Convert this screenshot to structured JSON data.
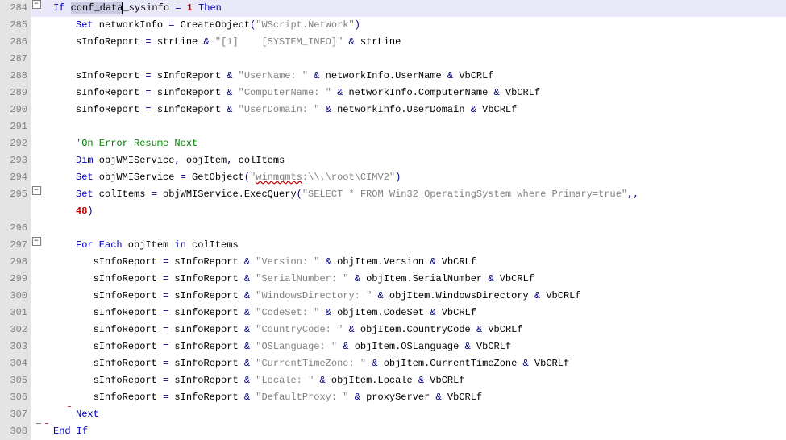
{
  "lines": [
    {
      "num": "284",
      "fold": "minus",
      "foldLine": "frombox",
      "redLine": "start",
      "hl": true,
      "segs": [
        {
          "c": "kw",
          "t": "If"
        },
        {
          "c": "txt",
          "t": " "
        },
        {
          "c": "txt sel",
          "t": "conf_data"
        },
        {
          "c": "txt caret",
          "t": "_sysinfo"
        },
        {
          "c": "txt",
          "t": " "
        },
        {
          "c": "op",
          "t": "="
        },
        {
          "c": "txt",
          "t": " "
        },
        {
          "c": "num",
          "t": "1"
        },
        {
          "c": "txt",
          "t": " "
        },
        {
          "c": "kw",
          "t": "Then"
        }
      ]
    },
    {
      "num": "285",
      "foldLine": "full",
      "redLine": "full",
      "indent": 1,
      "segs": [
        {
          "c": "kw",
          "t": "Set"
        },
        {
          "c": "txt",
          "t": " networkInfo "
        },
        {
          "c": "op",
          "t": "="
        },
        {
          "c": "txt",
          "t": " CreateObject"
        },
        {
          "c": "op",
          "t": "("
        },
        {
          "c": "str",
          "t": "\"WScript.NetWork\""
        },
        {
          "c": "op",
          "t": ")"
        }
      ]
    },
    {
      "num": "286",
      "foldLine": "full",
      "redLine": "full",
      "indent": 1,
      "segs": [
        {
          "c": "txt",
          "t": "sInfoReport "
        },
        {
          "c": "op",
          "t": "="
        },
        {
          "c": "txt",
          "t": " strLine "
        },
        {
          "c": "op",
          "t": "&"
        },
        {
          "c": "txt",
          "t": " "
        },
        {
          "c": "str",
          "t": "\"[1]    [SYSTEM_INFO]\""
        },
        {
          "c": "txt",
          "t": " "
        },
        {
          "c": "op",
          "t": "&"
        },
        {
          "c": "txt",
          "t": " strLine"
        }
      ]
    },
    {
      "num": "287",
      "foldLine": "full",
      "redLine": "full",
      "indent": 1,
      "segs": []
    },
    {
      "num": "288",
      "foldLine": "full",
      "redLine": "full",
      "indent": 1,
      "segs": [
        {
          "c": "txt",
          "t": "sInfoReport "
        },
        {
          "c": "op",
          "t": "="
        },
        {
          "c": "txt",
          "t": " sInfoReport "
        },
        {
          "c": "op",
          "t": "&"
        },
        {
          "c": "txt",
          "t": " "
        },
        {
          "c": "str",
          "t": "\"UserName: \""
        },
        {
          "c": "txt",
          "t": " "
        },
        {
          "c": "op",
          "t": "&"
        },
        {
          "c": "txt",
          "t": " networkInfo.UserName "
        },
        {
          "c": "op",
          "t": "&"
        },
        {
          "c": "txt",
          "t": " VbCRLf"
        }
      ]
    },
    {
      "num": "289",
      "foldLine": "full",
      "redLine": "full",
      "indent": 1,
      "segs": [
        {
          "c": "txt",
          "t": "sInfoReport "
        },
        {
          "c": "op",
          "t": "="
        },
        {
          "c": "txt",
          "t": " sInfoReport "
        },
        {
          "c": "op",
          "t": "&"
        },
        {
          "c": "txt",
          "t": " "
        },
        {
          "c": "str",
          "t": "\"ComputerName: \""
        },
        {
          "c": "txt",
          "t": " "
        },
        {
          "c": "op",
          "t": "&"
        },
        {
          "c": "txt",
          "t": " networkInfo.ComputerName "
        },
        {
          "c": "op",
          "t": "&"
        },
        {
          "c": "txt",
          "t": " VbCRLf"
        }
      ]
    },
    {
      "num": "290",
      "foldLine": "full",
      "redLine": "full",
      "indent": 1,
      "segs": [
        {
          "c": "txt",
          "t": "sInfoReport "
        },
        {
          "c": "op",
          "t": "="
        },
        {
          "c": "txt",
          "t": " sInfoReport "
        },
        {
          "c": "op",
          "t": "&"
        },
        {
          "c": "txt",
          "t": " "
        },
        {
          "c": "str",
          "t": "\"UserDomain: \""
        },
        {
          "c": "txt",
          "t": " "
        },
        {
          "c": "op",
          "t": "&"
        },
        {
          "c": "txt",
          "t": " networkInfo.UserDomain "
        },
        {
          "c": "op",
          "t": "&"
        },
        {
          "c": "txt",
          "t": " VbCRLf"
        }
      ]
    },
    {
      "num": "291",
      "foldLine": "full",
      "redLine": "full",
      "indent": 1,
      "segs": []
    },
    {
      "num": "292",
      "foldLine": "full",
      "redLine": "full",
      "indent": 1,
      "segs": [
        {
          "c": "cmt",
          "t": "'On Error Resume Next"
        }
      ]
    },
    {
      "num": "293",
      "foldLine": "full",
      "redLine": "full",
      "indent": 1,
      "segs": [
        {
          "c": "kw",
          "t": "Dim"
        },
        {
          "c": "txt",
          "t": " objWMIService"
        },
        {
          "c": "op",
          "t": ","
        },
        {
          "c": "txt",
          "t": " objItem"
        },
        {
          "c": "op",
          "t": ","
        },
        {
          "c": "txt",
          "t": " colItems"
        }
      ]
    },
    {
      "num": "294",
      "foldLine": "full",
      "redLine": "full",
      "indent": 1,
      "segs": [
        {
          "c": "kw",
          "t": "Set"
        },
        {
          "c": "txt",
          "t": " objWMIService "
        },
        {
          "c": "op",
          "t": "="
        },
        {
          "c": "txt",
          "t": " GetObject"
        },
        {
          "c": "op",
          "t": "("
        },
        {
          "c": "str",
          "t": "\""
        },
        {
          "c": "str wavy",
          "t": "winmgmts"
        },
        {
          "c": "str",
          "t": ":\\\\.\\root\\CIMV2\""
        },
        {
          "c": "op",
          "t": ")"
        }
      ]
    },
    {
      "num": "295",
      "fold": "minus",
      "foldLine": "full",
      "redLine": "full",
      "indent": 1,
      "segs": [
        {
          "c": "kw",
          "t": "Set"
        },
        {
          "c": "txt",
          "t": " colItems "
        },
        {
          "c": "op",
          "t": "="
        },
        {
          "c": "txt",
          "t": " objWMIService.ExecQuery"
        },
        {
          "c": "op",
          "t": "("
        },
        {
          "c": "str",
          "t": "\"SELECT * FROM Win32_OperatingSystem where Primary=true\""
        },
        {
          "c": "op",
          "t": ",,"
        }
      ]
    },
    {
      "num": "   ",
      "foldLine": "full",
      "redLine": "full",
      "indent": 1,
      "segs": [
        {
          "c": "num",
          "t": "48"
        },
        {
          "c": "op",
          "t": ")"
        }
      ]
    },
    {
      "num": "296",
      "foldLine": "full",
      "redLine": "full",
      "indent": 1,
      "segs": []
    },
    {
      "num": "297",
      "fold": "minus",
      "foldLine": "full",
      "redLine": "full",
      "indent": 1,
      "innerRed": "start",
      "segs": [
        {
          "c": "kw",
          "t": "For Each"
        },
        {
          "c": "txt",
          "t": " objItem "
        },
        {
          "c": "kw",
          "t": "in"
        },
        {
          "c": "txt",
          "t": " colItems"
        }
      ]
    },
    {
      "num": "298",
      "foldLine": "full",
      "redLine": "full",
      "indent": 2,
      "innerRed": "full",
      "segs": [
        {
          "c": "txt",
          "t": "sInfoReport "
        },
        {
          "c": "op",
          "t": "="
        },
        {
          "c": "txt",
          "t": " sInfoReport "
        },
        {
          "c": "op",
          "t": "&"
        },
        {
          "c": "txt",
          "t": " "
        },
        {
          "c": "str",
          "t": "\"Version: \""
        },
        {
          "c": "txt",
          "t": " "
        },
        {
          "c": "op",
          "t": "&"
        },
        {
          "c": "txt",
          "t": " objItem.Version "
        },
        {
          "c": "op",
          "t": "&"
        },
        {
          "c": "txt",
          "t": " VbCRLf"
        }
      ]
    },
    {
      "num": "299",
      "foldLine": "full",
      "redLine": "full",
      "indent": 2,
      "innerRed": "full",
      "segs": [
        {
          "c": "txt",
          "t": "sInfoReport "
        },
        {
          "c": "op",
          "t": "="
        },
        {
          "c": "txt",
          "t": " sInfoReport "
        },
        {
          "c": "op",
          "t": "&"
        },
        {
          "c": "txt",
          "t": " "
        },
        {
          "c": "str",
          "t": "\"SerialNumber: \""
        },
        {
          "c": "txt",
          "t": " "
        },
        {
          "c": "op",
          "t": "&"
        },
        {
          "c": "txt",
          "t": " objItem.SerialNumber "
        },
        {
          "c": "op",
          "t": "&"
        },
        {
          "c": "txt",
          "t": " VbCRLf"
        }
      ]
    },
    {
      "num": "300",
      "foldLine": "full",
      "redLine": "full",
      "indent": 2,
      "innerRed": "full",
      "segs": [
        {
          "c": "txt",
          "t": "sInfoReport "
        },
        {
          "c": "op",
          "t": "="
        },
        {
          "c": "txt",
          "t": " sInfoReport "
        },
        {
          "c": "op",
          "t": "&"
        },
        {
          "c": "txt",
          "t": " "
        },
        {
          "c": "str",
          "t": "\"WindowsDirectory: \""
        },
        {
          "c": "txt",
          "t": " "
        },
        {
          "c": "op",
          "t": "&"
        },
        {
          "c": "txt",
          "t": " objItem.WindowsDirectory "
        },
        {
          "c": "op",
          "t": "&"
        },
        {
          "c": "txt",
          "t": " VbCRLf"
        }
      ]
    },
    {
      "num": "301",
      "foldLine": "full",
      "redLine": "full",
      "indent": 2,
      "innerRed": "full",
      "segs": [
        {
          "c": "txt",
          "t": "sInfoReport "
        },
        {
          "c": "op",
          "t": "="
        },
        {
          "c": "txt",
          "t": " sInfoReport "
        },
        {
          "c": "op",
          "t": "&"
        },
        {
          "c": "txt",
          "t": " "
        },
        {
          "c": "str",
          "t": "\"CodeSet: \""
        },
        {
          "c": "txt",
          "t": " "
        },
        {
          "c": "op",
          "t": "&"
        },
        {
          "c": "txt",
          "t": " objItem.CodeSet "
        },
        {
          "c": "op",
          "t": "&"
        },
        {
          "c": "txt",
          "t": " VbCRLf"
        }
      ]
    },
    {
      "num": "302",
      "foldLine": "full",
      "redLine": "full",
      "indent": 2,
      "innerRed": "full",
      "segs": [
        {
          "c": "txt",
          "t": "sInfoReport "
        },
        {
          "c": "op",
          "t": "="
        },
        {
          "c": "txt",
          "t": " sInfoReport "
        },
        {
          "c": "op",
          "t": "&"
        },
        {
          "c": "txt",
          "t": " "
        },
        {
          "c": "str",
          "t": "\"CountryCode: \""
        },
        {
          "c": "txt",
          "t": " "
        },
        {
          "c": "op",
          "t": "&"
        },
        {
          "c": "txt",
          "t": " objItem.CountryCode "
        },
        {
          "c": "op",
          "t": "&"
        },
        {
          "c": "txt",
          "t": " VbCRLf"
        }
      ]
    },
    {
      "num": "303",
      "foldLine": "full",
      "redLine": "full",
      "indent": 2,
      "innerRed": "full",
      "segs": [
        {
          "c": "txt",
          "t": "sInfoReport "
        },
        {
          "c": "op",
          "t": "="
        },
        {
          "c": "txt",
          "t": " sInfoReport "
        },
        {
          "c": "op",
          "t": "&"
        },
        {
          "c": "txt",
          "t": " "
        },
        {
          "c": "str",
          "t": "\"OSLanguage: \""
        },
        {
          "c": "txt",
          "t": " "
        },
        {
          "c": "op",
          "t": "&"
        },
        {
          "c": "txt",
          "t": " objItem.OSLanguage "
        },
        {
          "c": "op",
          "t": "&"
        },
        {
          "c": "txt",
          "t": " VbCRLf"
        }
      ]
    },
    {
      "num": "304",
      "foldLine": "full",
      "redLine": "full",
      "indent": 2,
      "innerRed": "full",
      "segs": [
        {
          "c": "txt",
          "t": "sInfoReport "
        },
        {
          "c": "op",
          "t": "="
        },
        {
          "c": "txt",
          "t": " sInfoReport "
        },
        {
          "c": "op",
          "t": "&"
        },
        {
          "c": "txt",
          "t": " "
        },
        {
          "c": "str",
          "t": "\"CurrentTimeZone: \""
        },
        {
          "c": "txt",
          "t": " "
        },
        {
          "c": "op",
          "t": "&"
        },
        {
          "c": "txt",
          "t": " objItem.CurrentTimeZone "
        },
        {
          "c": "op",
          "t": "&"
        },
        {
          "c": "txt",
          "t": " VbCRLf"
        }
      ]
    },
    {
      "num": "305",
      "foldLine": "full",
      "redLine": "full",
      "indent": 2,
      "innerRed": "full",
      "segs": [
        {
          "c": "txt",
          "t": "sInfoReport "
        },
        {
          "c": "op",
          "t": "="
        },
        {
          "c": "txt",
          "t": " sInfoReport "
        },
        {
          "c": "op",
          "t": "&"
        },
        {
          "c": "txt",
          "t": " "
        },
        {
          "c": "str",
          "t": "\"Locale: \""
        },
        {
          "c": "txt",
          "t": " "
        },
        {
          "c": "op",
          "t": "&"
        },
        {
          "c": "txt",
          "t": " objItem.Locale "
        },
        {
          "c": "op",
          "t": "&"
        },
        {
          "c": "txt",
          "t": " VbCRLf"
        }
      ]
    },
    {
      "num": "306",
      "foldLine": "full",
      "redLine": "full",
      "indent": 2,
      "innerRed": "full",
      "segs": [
        {
          "c": "txt",
          "t": "sInfoReport "
        },
        {
          "c": "op",
          "t": "="
        },
        {
          "c": "txt",
          "t": " sInfoReport "
        },
        {
          "c": "op",
          "t": "&"
        },
        {
          "c": "txt",
          "t": " "
        },
        {
          "c": "str",
          "t": "\"DefaultProxy: \""
        },
        {
          "c": "txt",
          "t": " "
        },
        {
          "c": "op",
          "t": "&"
        },
        {
          "c": "txt",
          "t": " proxyServer "
        },
        {
          "c": "op",
          "t": "&"
        },
        {
          "c": "txt",
          "t": " VbCRLf"
        }
      ]
    },
    {
      "num": "307",
      "foldLine": "full",
      "redLine": "full",
      "indent": 1,
      "innerRed": "end",
      "segs": [
        {
          "c": "kw",
          "t": "Next"
        }
      ]
    },
    {
      "num": "308",
      "fold": "end",
      "foldLine": "tobox",
      "redLine": "end",
      "segs": [
        {
          "c": "kw",
          "t": "End If"
        }
      ]
    }
  ],
  "foldMinusGlyph": "−"
}
